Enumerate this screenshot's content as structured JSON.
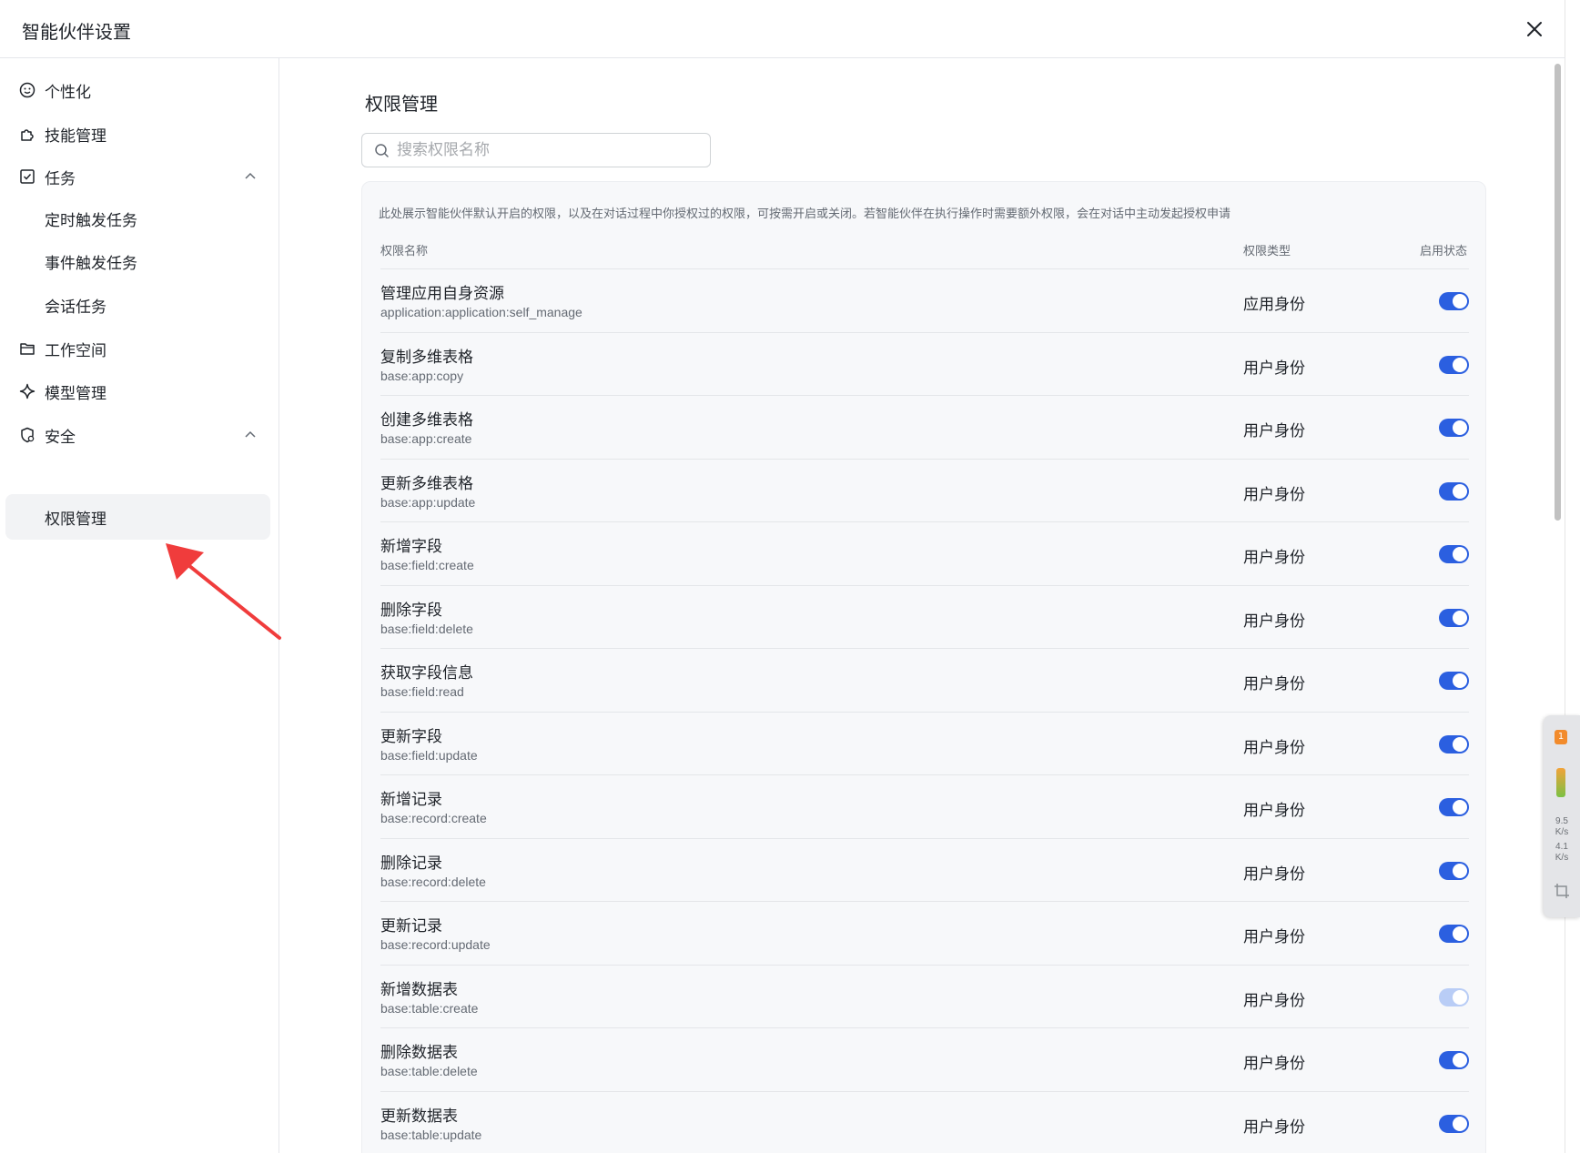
{
  "header": {
    "title": "智能伙伴设置"
  },
  "sidebar": {
    "items": [
      {
        "label": "个性化",
        "icon": "smile-icon"
      },
      {
        "label": "技能管理",
        "icon": "puzzle-icon"
      },
      {
        "label": "任务",
        "icon": "checkbox-icon",
        "expanded": true
      },
      {
        "label": "定时触发任务"
      },
      {
        "label": "事件触发任务"
      },
      {
        "label": "会话任务"
      },
      {
        "label": "工作空间",
        "icon": "folder-icon"
      },
      {
        "label": "模型管理",
        "icon": "sparkle-icon"
      },
      {
        "label": "安全",
        "icon": "shield-icon",
        "expanded": true
      },
      {
        "label": "权限管理",
        "active": true
      }
    ]
  },
  "main": {
    "title": "权限管理",
    "search": {
      "placeholder": "搜索权限名称",
      "value": ""
    },
    "description": "此处展示智能伙伴默认开启的权限，以及在对话过程中你授权过的权限，可按需开启或关闭。若智能伙伴在执行操作时需要额外权限，会在对话中主动发起授权申请",
    "columns": {
      "name": "权限名称",
      "type": "权限类型",
      "status": "启用状态"
    },
    "rows": [
      {
        "name": "管理应用自身资源",
        "code": "application:application:self_manage",
        "type": "应用身份",
        "enabled": true
      },
      {
        "name": "复制多维表格",
        "code": "base:app:copy",
        "type": "用户身份",
        "enabled": true
      },
      {
        "name": "创建多维表格",
        "code": "base:app:create",
        "type": "用户身份",
        "enabled": true
      },
      {
        "name": "更新多维表格",
        "code": "base:app:update",
        "type": "用户身份",
        "enabled": true
      },
      {
        "name": "新增字段",
        "code": "base:field:create",
        "type": "用户身份",
        "enabled": true
      },
      {
        "name": "删除字段",
        "code": "base:field:delete",
        "type": "用户身份",
        "enabled": true
      },
      {
        "name": "获取字段信息",
        "code": "base:field:read",
        "type": "用户身份",
        "enabled": true
      },
      {
        "name": "更新字段",
        "code": "base:field:update",
        "type": "用户身份",
        "enabled": true
      },
      {
        "name": "新增记录",
        "code": "base:record:create",
        "type": "用户身份",
        "enabled": true
      },
      {
        "name": "删除记录",
        "code": "base:record:delete",
        "type": "用户身份",
        "enabled": true
      },
      {
        "name": "更新记录",
        "code": "base:record:update",
        "type": "用户身份",
        "enabled": true
      },
      {
        "name": "新增数据表",
        "code": "base:table:create",
        "type": "用户身份",
        "enabled": true,
        "disabled": true
      },
      {
        "name": "删除数据表",
        "code": "base:table:delete",
        "type": "用户身份",
        "enabled": true
      },
      {
        "name": "更新数据表",
        "code": "base:table:update",
        "type": "用户身份",
        "enabled": true
      }
    ]
  },
  "widget": {
    "badge": "1",
    "upload": "9.5",
    "download": "4.1",
    "unit": "K/s"
  },
  "colors": {
    "accent": "#2b5fe0",
    "annotation": "#f03c3c",
    "active_bg": "#f2f3f5"
  }
}
